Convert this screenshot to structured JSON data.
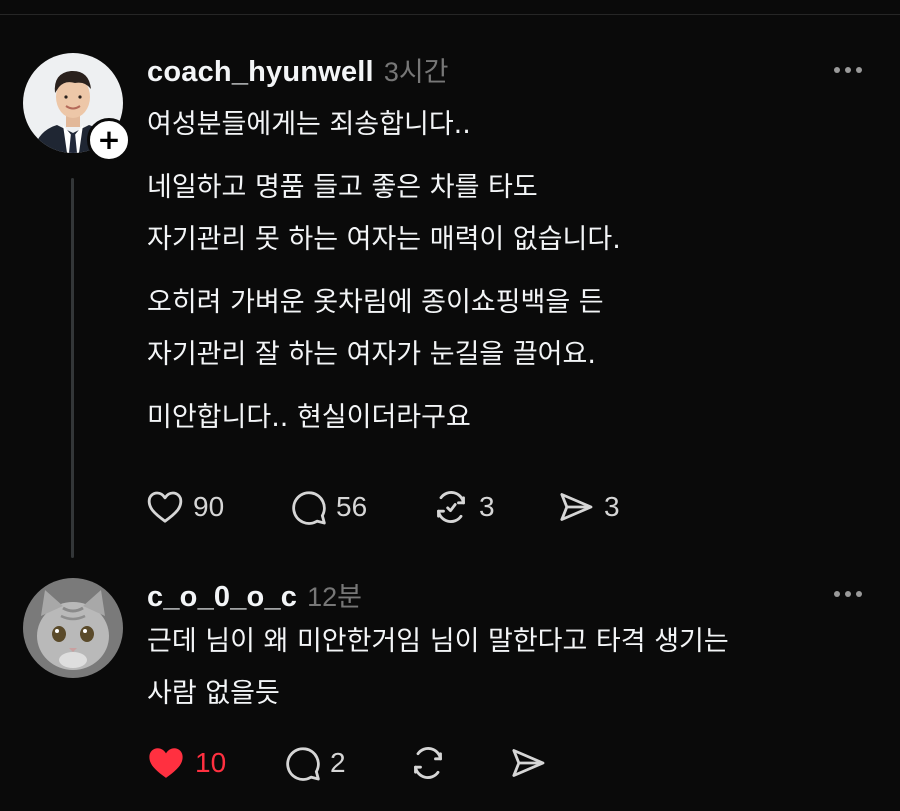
{
  "posts": [
    {
      "username": "coach_hyunwell",
      "time": "3시간",
      "avatar_icon": "profile-photo-man-suit",
      "follow_badge": "+",
      "paragraphs": [
        [
          "여성분들에게는 죄송합니다.."
        ],
        [
          "네일하고 명품 들고 좋은 차를 타도",
          "자기관리 못 하는 여자는 매력이 없습니다."
        ],
        [
          "오히려 가벼운 옷차림에 종이쇼핑백을 든",
          "자기관리 잘 하는 여자가 눈길을 끌어요."
        ],
        [
          "미안합니다.. 현실이더라구요"
        ]
      ],
      "likes": "90",
      "liked": false,
      "comments": "56",
      "reposts": "3",
      "shares": "3"
    },
    {
      "username": "c_o_0_o_c",
      "time": "12분",
      "avatar_icon": "profile-photo-gray-cat",
      "paragraphs": [
        [
          "근데 님이 왜 미안한거임 님이 말한다고 타격 생기는",
          "사람 없을듯"
        ]
      ],
      "likes": "10",
      "liked": true,
      "comments": "2",
      "reposts": "",
      "shares": ""
    }
  ],
  "colors": {
    "background": "#0a0a0a",
    "text": "#f3f5f7",
    "muted": "#777777",
    "like_active": "#ff3040"
  }
}
